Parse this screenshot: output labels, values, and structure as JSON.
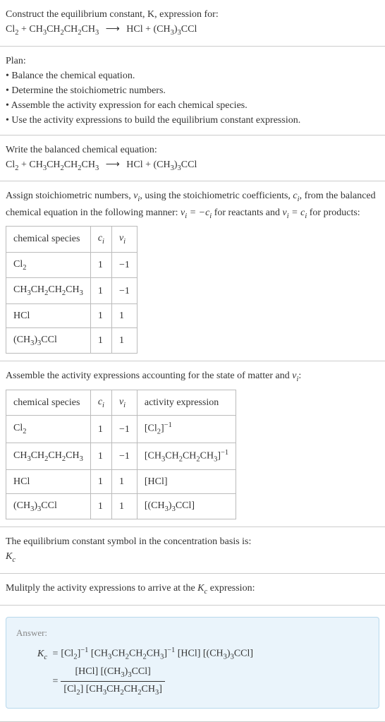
{
  "intro": {
    "line1": "Construct the equilibrium constant, K, expression for:",
    "equation_left": "Cl₂ + CH₃CH₂CH₂CH₃",
    "arrow": "⟶",
    "equation_right": "HCl + (CH₃)₃CCl"
  },
  "plan": {
    "heading": "Plan:",
    "bullets": [
      "• Balance the chemical equation.",
      "• Determine the stoichiometric numbers.",
      "• Assemble the activity expression for each chemical species.",
      "• Use the activity expressions to build the equilibrium constant expression."
    ]
  },
  "balanced": {
    "heading": "Write the balanced chemical equation:",
    "equation_left": "Cl₂ + CH₃CH₂CH₂CH₃",
    "arrow": "⟶",
    "equation_right": "HCl + (CH₃)₃CCl"
  },
  "stoich": {
    "text_part1": "Assign stoichiometric numbers, ",
    "nu_i": "νᵢ",
    "text_part2": ", using the stoichiometric coefficients, ",
    "c_i": "cᵢ",
    "text_part3": ", from the balanced chemical equation in the following manner: ",
    "rel1": "νᵢ = −cᵢ",
    "text_part4": " for reactants and ",
    "rel2": "νᵢ = cᵢ",
    "text_part5": " for products:",
    "table": {
      "headers": [
        "chemical species",
        "cᵢ",
        "νᵢ"
      ],
      "rows": [
        [
          "Cl₂",
          "1",
          "−1"
        ],
        [
          "CH₃CH₂CH₂CH₃",
          "1",
          "−1"
        ],
        [
          "HCl",
          "1",
          "1"
        ],
        [
          "(CH₃)₃CCl",
          "1",
          "1"
        ]
      ]
    }
  },
  "activity": {
    "heading": "Assemble the activity expressions accounting for the state of matter and νᵢ:",
    "table": {
      "headers": [
        "chemical species",
        "cᵢ",
        "νᵢ",
        "activity expression"
      ],
      "rows": [
        [
          "Cl₂",
          "1",
          "−1",
          "[Cl₂]⁻¹"
        ],
        [
          "CH₃CH₂CH₂CH₃",
          "1",
          "−1",
          "[CH₃CH₂CH₂CH₃]⁻¹"
        ],
        [
          "HCl",
          "1",
          "1",
          "[HCl]"
        ],
        [
          "(CH₃)₃CCl",
          "1",
          "1",
          "[(CH₃)₃CCl]"
        ]
      ]
    }
  },
  "eqconst": {
    "heading": "The equilibrium constant symbol in the concentration basis is:",
    "symbol": "K_c"
  },
  "multiply": {
    "heading": "Mulitply the activity expressions to arrive at the K_c expression:"
  },
  "answer": {
    "label": "Answer:",
    "kc": "K_c",
    "eq": "=",
    "expr1": "[Cl₂]⁻¹ [CH₃CH₂CH₂CH₃]⁻¹ [HCl] [(CH₃)₃CCl]",
    "numerator": "[HCl] [(CH₃)₃CCl]",
    "denominator": "[Cl₂] [CH₃CH₂CH₂CH₃]"
  }
}
